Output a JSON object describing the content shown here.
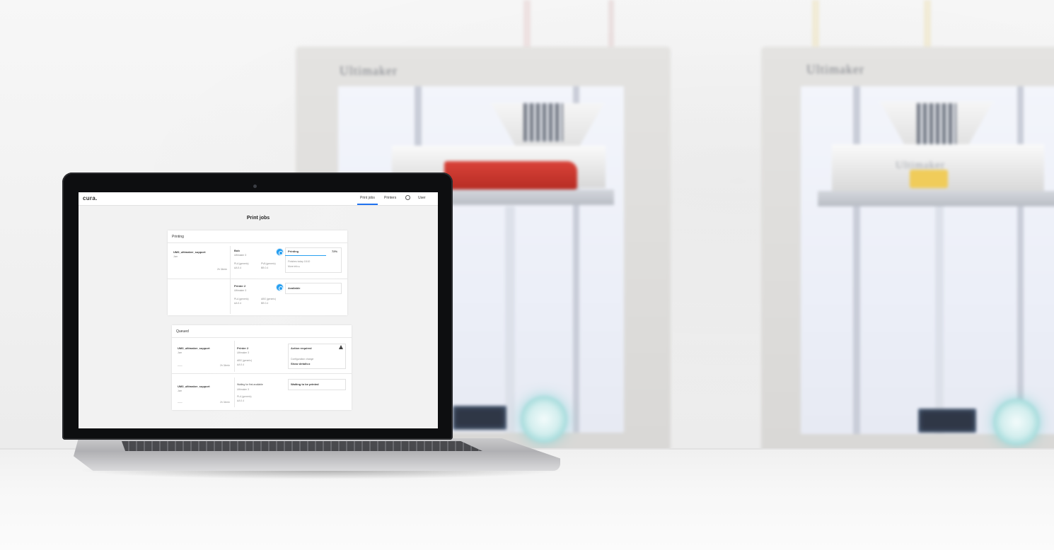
{
  "colors": {
    "accent": "#1d9bf0",
    "nav_active": "#196ef0",
    "print_red": "#d94339",
    "print_yellow": "#f0cc5a",
    "printer_frame": "#dedddb"
  },
  "printers": {
    "left_brand": "Ultimaker",
    "right_brand": "Ultimaker"
  },
  "app": {
    "logo": "cura.",
    "nav": {
      "print_jobs": "Print jobs",
      "printers": "Printers",
      "settings_icon": "gear-icon",
      "user": "User"
    },
    "page_title": "Print jobs",
    "printing": {
      "header": "Printing",
      "job": {
        "name": "UM3_ultimaker_support",
        "owner": "Jcm",
        "time": "2h 34min"
      },
      "printer_1": {
        "name": "Bob",
        "model": "Ultimaker 3",
        "core_1_label": "PLA (generic)",
        "core_1_value": "AA 0.4",
        "core_2_label": "PVA (generic)",
        "core_2_value": "BB 0.4",
        "status": "Printing",
        "progress_percent": "72%",
        "progress_value": 0.72,
        "finish": "Finishes today 18:10",
        "more": "More info  ▸"
      },
      "printer_2": {
        "name": "Printer 2",
        "model": "Ultimaker 3",
        "core_1_label": "PLA (generic)",
        "core_1_value": "AA 0.4",
        "core_2_label": "ABS (generic)",
        "core_2_value": "BB 0.4",
        "status": "Available"
      }
    },
    "queued": {
      "header": "Queued",
      "job_1": {
        "name": "UM3_ultimaker_support",
        "owner": "Jcm",
        "dash": "——",
        "time": "2h 34min",
        "printer": "Printer 2",
        "model": "Ultimaker 3",
        "core_label": "ABS (generic)",
        "core_value": "AA 0.4",
        "status": "Action required",
        "detail": "Configuration change",
        "detail_link": "Show details ▸"
      },
      "job_2": {
        "name": "UM3_ultimaker_support",
        "owner": "Jcm",
        "dash": "——",
        "time": "2h 34min",
        "printer": "Waiting for first available",
        "model": "Ultimaker 3",
        "core_label": "PLA (generic)",
        "core_value": "AA 0.4",
        "status": "Waiting to be printed"
      }
    }
  }
}
